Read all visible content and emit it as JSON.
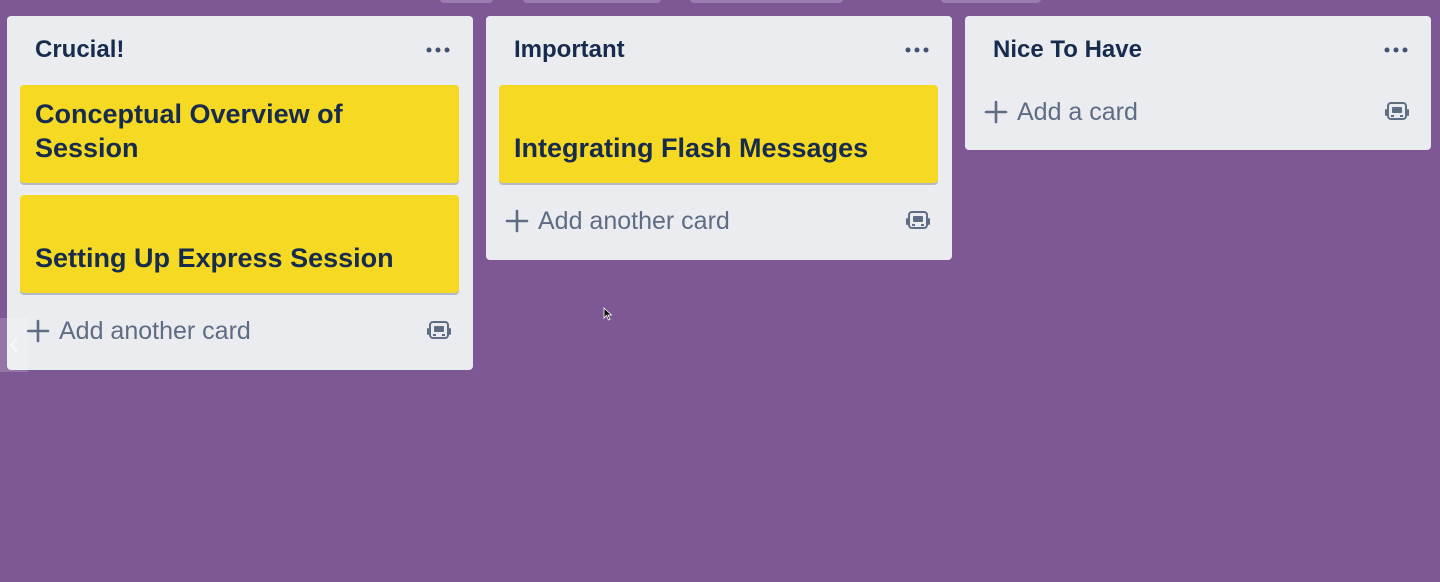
{
  "lists": [
    {
      "title": "Crucial!",
      "cards": [
        "Conceptual Overview of Session",
        "Setting Up Express Session"
      ],
      "add_label": "Add another card"
    },
    {
      "title": "Important",
      "cards": [
        "Integrating Flash Messages"
      ],
      "add_label": "Add another card"
    },
    {
      "title": "Nice To Have",
      "cards": [],
      "add_label": "Add a card"
    }
  ],
  "icons": {
    "menu": "ellipsis-icon",
    "add": "plus-icon",
    "template": "card-template-icon",
    "scroll": "chevron-left-icon"
  },
  "colors": {
    "background": "#7e5795",
    "list": "#ebecf0",
    "card": "#f5d923",
    "title_text": "#172b4d",
    "muted_text": "#5e6c84"
  }
}
